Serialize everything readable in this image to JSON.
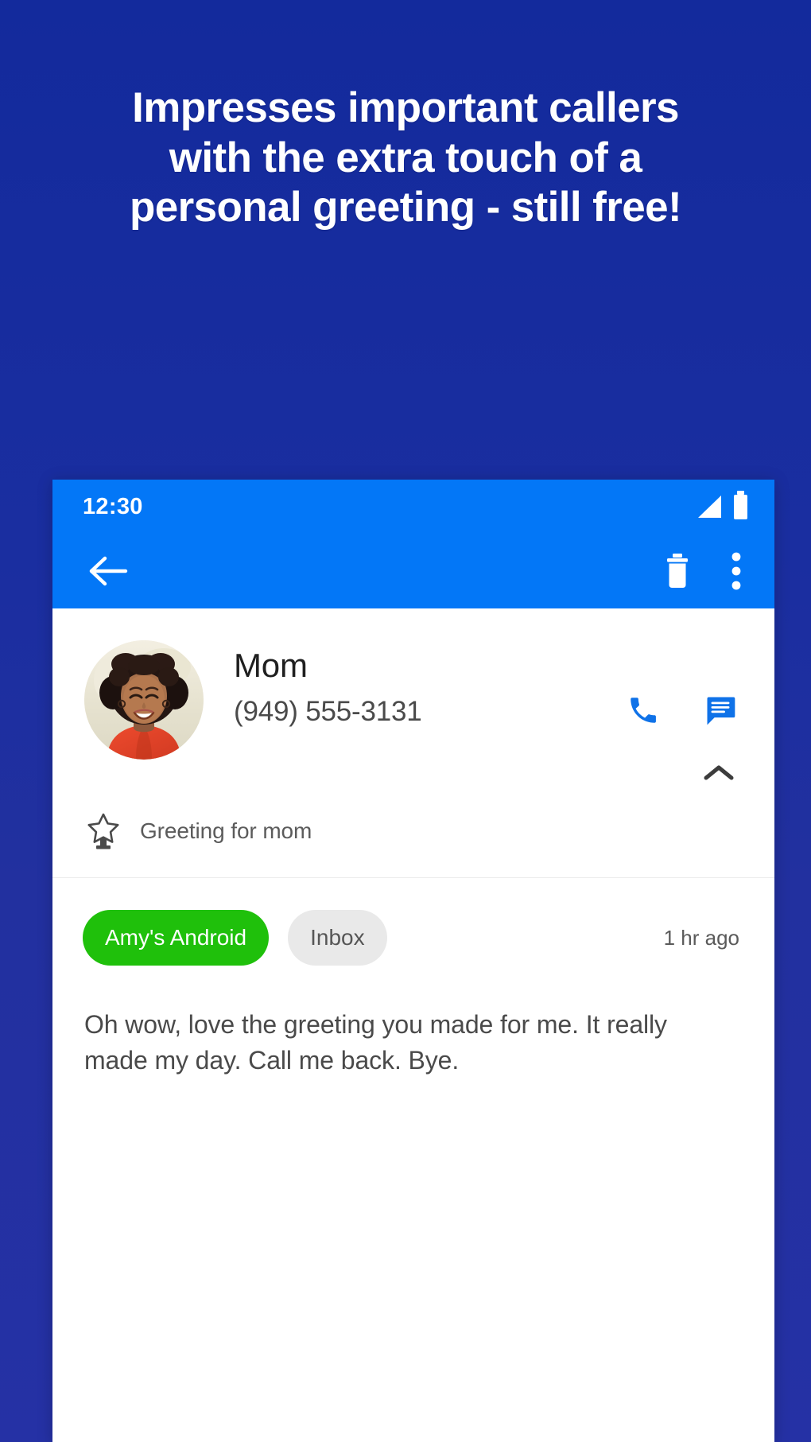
{
  "promo": {
    "headline_lines": [
      "Impresses important callers",
      "with the extra touch of a",
      "personal greeting - still free!"
    ],
    "background_color": "#18299B",
    "headline_color": "#FFFFFF"
  },
  "phone": {
    "status_bar": {
      "time": "12:30",
      "signal_icon": "signal-bars-icon",
      "battery_icon": "battery-full-icon",
      "background_color": "#0377F7"
    },
    "app_bar": {
      "back_icon": "back-arrow-icon",
      "delete_icon": "trash-icon",
      "overflow_icon": "more-vertical-icon",
      "background_color": "#0377F7"
    },
    "contact": {
      "avatar_alt": "contact-photo",
      "name": "Mom",
      "phone_number": "(949) 555-3131",
      "call_icon": "phone-call-icon",
      "message_icon": "message-icon",
      "collapse_icon": "chevron-up-icon",
      "action_color": "#0F72E8"
    },
    "greeting": {
      "icon": "star-greeting-icon",
      "label": "Greeting for mom"
    },
    "message": {
      "device_chip": "Amy's Android",
      "device_chip_color": "#1FC00B",
      "folder_chip": "Inbox",
      "folder_chip_color": "#E9E9E9",
      "timestamp": "1 hr ago",
      "transcript": "Oh wow, love the greeting you made for me. It really made my day. Call me back. Bye."
    }
  }
}
